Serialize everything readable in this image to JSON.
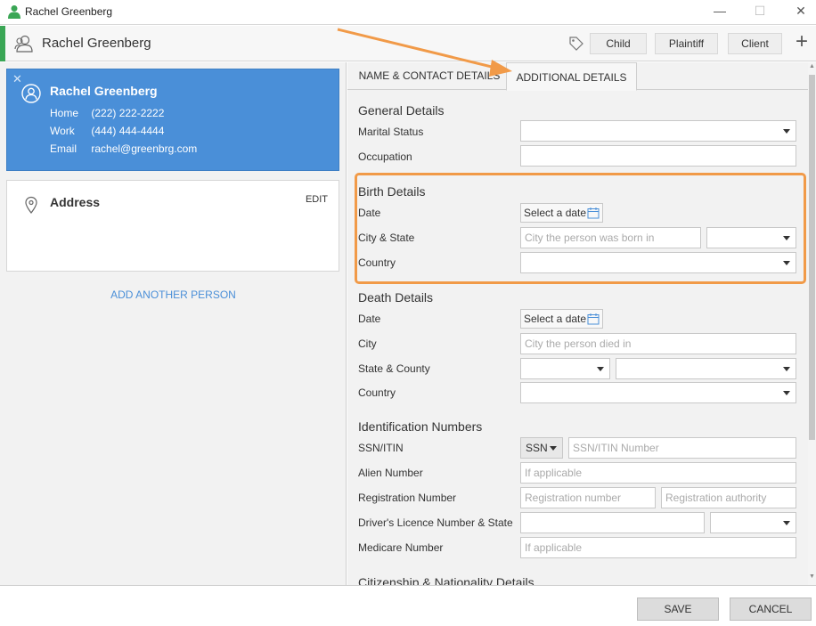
{
  "window": {
    "title": "Rachel Greenberg",
    "minimize": "—",
    "maximize": "☐",
    "close": "✕"
  },
  "header": {
    "name": "Rachel Greenberg",
    "roles": [
      "Child",
      "Plaintiff",
      "Client"
    ],
    "add": "+"
  },
  "person_card": {
    "name": "Rachel Greenberg",
    "close": "✕",
    "contacts": [
      {
        "label": "Home",
        "value": "(222) 222-2222"
      },
      {
        "label": "Work",
        "value": "(444) 444-4444"
      },
      {
        "label": "Email",
        "value": "rachel@greenbrg.com"
      }
    ]
  },
  "address_card": {
    "title": "Address",
    "edit_label": "EDIT"
  },
  "add_person_label": "ADD ANOTHER PERSON",
  "tabs": [
    {
      "label": "NAME & CONTACT DETAILS",
      "active": false
    },
    {
      "label": "ADDITIONAL DETAILS",
      "active": true
    }
  ],
  "general": {
    "title": "General Details",
    "marital_status_label": "Marital Status",
    "occupation_label": "Occupation"
  },
  "birth": {
    "title": "Birth Details",
    "date_label": "Date",
    "date_button": "Select a date",
    "city_state_label": "City & State",
    "city_placeholder": "City the person was born in",
    "country_label": "Country"
  },
  "death": {
    "title": "Death Details",
    "date_label": "Date",
    "date_button": "Select a date",
    "city_label": "City",
    "city_placeholder": "City the person died in",
    "state_county_label": "State & County",
    "country_label": "Country"
  },
  "identification": {
    "title": "Identification Numbers",
    "ssn_label": "SSN/ITIN",
    "ssn_type": "SSN",
    "ssn_placeholder": "SSN/ITIN Number",
    "alien_label": "Alien Number",
    "alien_placeholder": "If applicable",
    "registration_label": "Registration Number",
    "registration_placeholder": "Registration number",
    "authority_placeholder": "Registration authority",
    "licence_label": "Driver's Licence Number & State",
    "medicare_label": "Medicare Number",
    "medicare_placeholder": "If applicable"
  },
  "citizenship": {
    "title": "Citizenship & Nationality Details"
  },
  "footer": {
    "save": "SAVE",
    "cancel": "CANCEL"
  },
  "colors": {
    "accent_green": "#3aa655",
    "card_blue": "#4a8fd8",
    "highlight_orange": "#f19a48"
  }
}
